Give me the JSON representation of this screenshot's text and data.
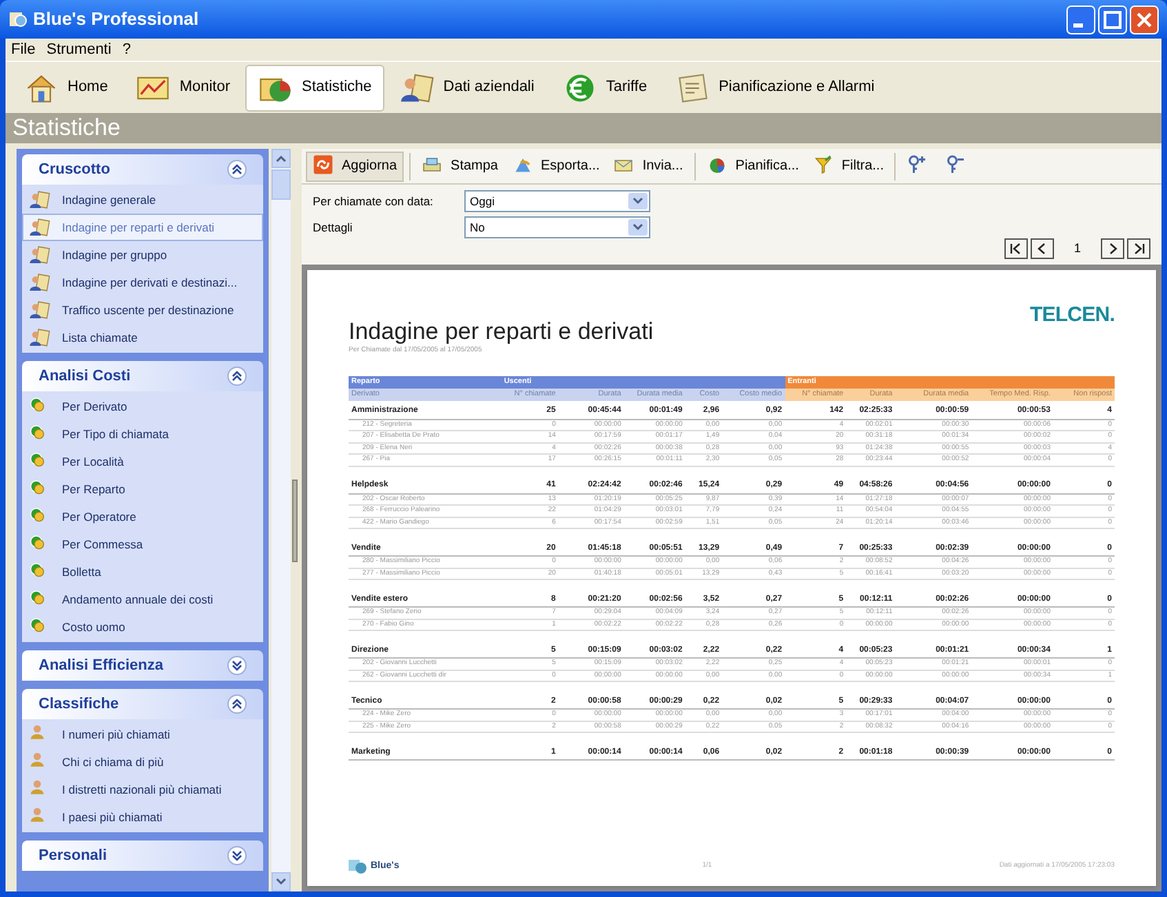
{
  "window": {
    "title": "Blue's Professional"
  },
  "menu": [
    "File",
    "Strumenti",
    "?"
  ],
  "nav": [
    {
      "label": "Home",
      "selected": false
    },
    {
      "label": "Monitor",
      "selected": false
    },
    {
      "label": "Statistiche",
      "selected": true
    },
    {
      "label": "Dati aziendali",
      "selected": false
    },
    {
      "label": "Tariffe",
      "selected": false
    },
    {
      "label": "Pianificazione e Allarmi",
      "selected": false
    }
  ],
  "page_title": "Statistiche",
  "sidebar": [
    {
      "title": "Cruscotto",
      "expanded": true,
      "items": [
        {
          "label": "Indagine generale",
          "selected": false
        },
        {
          "label": "Indagine per reparti e derivati",
          "selected": true
        },
        {
          "label": "Indagine per gruppo",
          "selected": false
        },
        {
          "label": "Indagine per derivati e destinazi...",
          "selected": false
        },
        {
          "label": "Traffico uscente per destinazione",
          "selected": false
        },
        {
          "label": "Lista chiamate",
          "selected": false
        }
      ]
    },
    {
      "title": "Analisi Costi",
      "expanded": true,
      "items": [
        {
          "label": "Per Derivato",
          "selected": false
        },
        {
          "label": "Per Tipo di chiamata",
          "selected": false
        },
        {
          "label": "Per Località",
          "selected": false
        },
        {
          "label": "Per Reparto",
          "selected": false
        },
        {
          "label": "Per Operatore",
          "selected": false
        },
        {
          "label": "Per Commessa",
          "selected": false
        },
        {
          "label": "Bolletta",
          "selected": false
        },
        {
          "label": "Andamento annuale dei costi",
          "selected": false
        },
        {
          "label": "Costo uomo",
          "selected": false
        }
      ]
    },
    {
      "title": "Analisi Efficienza",
      "expanded": false
    },
    {
      "title": "Classifiche",
      "expanded": true,
      "items": [
        {
          "label": "I numeri più chiamati",
          "selected": false
        },
        {
          "label": "Chi ci chiama di più",
          "selected": false
        },
        {
          "label": "I distretti nazionali più chiamati",
          "selected": false
        },
        {
          "label": "I paesi più chiamati",
          "selected": false
        }
      ]
    },
    {
      "title": "Personali",
      "expanded": false
    }
  ],
  "actions": [
    "Aggiorna",
    "Stampa",
    "Esporta...",
    "Invia...",
    "Pianifica...",
    "Filtra..."
  ],
  "filters": [
    {
      "label": "Per chiamate con data:",
      "value": "Oggi"
    },
    {
      "label": "Dettagli",
      "value": "No"
    }
  ],
  "pager": {
    "page": "1"
  },
  "report": {
    "title": "Indagine per reparti e derivati",
    "subtitle": "Per Chiamate dal 17/05/2005 al 17/05/2005",
    "brand": "TELCEN.",
    "footer_logo": "Blue's",
    "footer_page": "1/1",
    "footer_updated": "Dati aggiornati a 17/05/2005 17:23:03",
    "groups": [
      "Reparto",
      "Uscenti",
      "Entranti"
    ],
    "columns": [
      "Derivato",
      "N° chiamate",
      "Durata",
      "Durata media",
      "Costo",
      "Costo medio",
      "N° chiamate",
      "Durata",
      "Durata media",
      "Tempo Med. Risp.",
      "Non rispost"
    ],
    "rows": [
      {
        "kind": "group",
        "cells": [
          "Amministrazione",
          "25",
          "00:45:44",
          "00:01:49",
          "2,96",
          "0,92",
          "142",
          "02:25:33",
          "00:00:59",
          "00:00:53",
          "4"
        ]
      },
      {
        "kind": "detail",
        "cells": [
          "212 - Segreteria",
          "0",
          "00:00:00",
          "00:00:00",
          "0,00",
          "0,00",
          "4",
          "00:02:01",
          "00:00:30",
          "00:00:06",
          "0"
        ]
      },
      {
        "kind": "detail",
        "cells": [
          "207 - Elisabetta De Prato",
          "14",
          "00:17:59",
          "00:01:17",
          "1,49",
          "0,04",
          "20",
          "00:31:18",
          "00:01:34",
          "00:00:02",
          "0"
        ]
      },
      {
        "kind": "detail",
        "cells": [
          "209 - Elena Neri",
          "4",
          "00:02:26",
          "00:00:38",
          "0,28",
          "0,00",
          "93",
          "01:24:38",
          "00:00:55",
          "00:00:03",
          "4"
        ]
      },
      {
        "kind": "detail",
        "cells": [
          "267 - Pia",
          "17",
          "00:26:15",
          "00:01:11",
          "2,30",
          "0,05",
          "28",
          "00:23:44",
          "00:00:52",
          "00:00:04",
          "0"
        ]
      },
      {
        "kind": "group",
        "cells": [
          "Helpdesk",
          "41",
          "02:24:42",
          "00:02:46",
          "15,24",
          "0,29",
          "49",
          "04:58:26",
          "00:04:56",
          "00:00:00",
          "0"
        ]
      },
      {
        "kind": "detail",
        "cells": [
          "202 - Oscar Roberto",
          "13",
          "01:20:19",
          "00:05:25",
          "9,87",
          "0,39",
          "14",
          "01:27:18",
          "00:00:07",
          "00:00:00",
          "0"
        ]
      },
      {
        "kind": "detail",
        "cells": [
          "268 - Ferruccio Palearino",
          "22",
          "01:04:29",
          "00:03:01",
          "7,79",
          "0,24",
          "11",
          "00:54:04",
          "00:04:55",
          "00:00:00",
          "0"
        ]
      },
      {
        "kind": "detail",
        "cells": [
          "422 - Mario Gandiego",
          "6",
          "00:17:54",
          "00:02:59",
          "1,51",
          "0,05",
          "24",
          "01:20:14",
          "00:03:46",
          "00:00:00",
          "0"
        ]
      },
      {
        "kind": "group",
        "cells": [
          "Vendite",
          "20",
          "01:45:18",
          "00:05:51",
          "13,29",
          "0,49",
          "7",
          "00:25:33",
          "00:02:39",
          "00:00:00",
          "0"
        ]
      },
      {
        "kind": "detail",
        "cells": [
          "280 - Massimiliano Piccio",
          "0",
          "00:00:00",
          "00:00:00",
          "0,00",
          "0,06",
          "2",
          "00:08:52",
          "00:04:26",
          "00:00:00",
          "0"
        ]
      },
      {
        "kind": "detail",
        "cells": [
          "277 - Massimiliano Piccio",
          "20",
          "01:40:18",
          "00:05:01",
          "13,29",
          "0,43",
          "5",
          "00:16:41",
          "00:03:20",
          "00:00:00",
          "0"
        ]
      },
      {
        "kind": "group",
        "cells": [
          "Vendite estero",
          "8",
          "00:21:20",
          "00:02:56",
          "3,52",
          "0,27",
          "5",
          "00:12:11",
          "00:02:26",
          "00:00:00",
          "0"
        ]
      },
      {
        "kind": "detail",
        "cells": [
          "269 - Stefano Zerio",
          "7",
          "00:29:04",
          "00:04:09",
          "3,24",
          "0,27",
          "5",
          "00:12:11",
          "00:02:26",
          "00:00:00",
          "0"
        ]
      },
      {
        "kind": "detail",
        "cells": [
          "270 - Fabio Gino",
          "1",
          "00:02:22",
          "00:02:22",
          "0,28",
          "0,26",
          "0",
          "00:00:00",
          "00:00:00",
          "00:00:00",
          "0"
        ]
      },
      {
        "kind": "group",
        "cells": [
          "Direzione",
          "5",
          "00:15:09",
          "00:03:02",
          "2,22",
          "0,22",
          "4",
          "00:05:23",
          "00:01:21",
          "00:00:34",
          "1"
        ]
      },
      {
        "kind": "detail",
        "cells": [
          "202 - Giovanni Lucchetti",
          "5",
          "00:15:09",
          "00:03:02",
          "2,22",
          "0,25",
          "4",
          "00:05:23",
          "00:01:21",
          "00:00:01",
          "0"
        ]
      },
      {
        "kind": "detail",
        "cells": [
          "262 - Giovanni Lucchetti dir",
          "0",
          "00:00:00",
          "00:00:00",
          "0,00",
          "0,00",
          "0",
          "00:00:00",
          "00:00:00",
          "00:00:34",
          "1"
        ]
      },
      {
        "kind": "group",
        "cells": [
          "Tecnico",
          "2",
          "00:00:58",
          "00:00:29",
          "0,22",
          "0,02",
          "5",
          "00:29:33",
          "00:04:07",
          "00:00:00",
          "0"
        ]
      },
      {
        "kind": "detail",
        "cells": [
          "224 - Mike Zero",
          "0",
          "00:00:00",
          "00:00:00",
          "0,00",
          "0,00",
          "3",
          "00:17:01",
          "00:04:00",
          "00:00:00",
          "0"
        ]
      },
      {
        "kind": "detail",
        "cells": [
          "225 - Mike Zero",
          "2",
          "00:00:58",
          "00:00:29",
          "0,22",
          "0,05",
          "2",
          "00:08:32",
          "00:04:16",
          "00:00:00",
          "0"
        ]
      },
      {
        "kind": "group",
        "cells": [
          "Marketing",
          "1",
          "00:00:14",
          "00:00:14",
          "0,06",
          "0,02",
          "2",
          "00:01:18",
          "00:00:39",
          "00:00:00",
          "0"
        ]
      }
    ]
  }
}
